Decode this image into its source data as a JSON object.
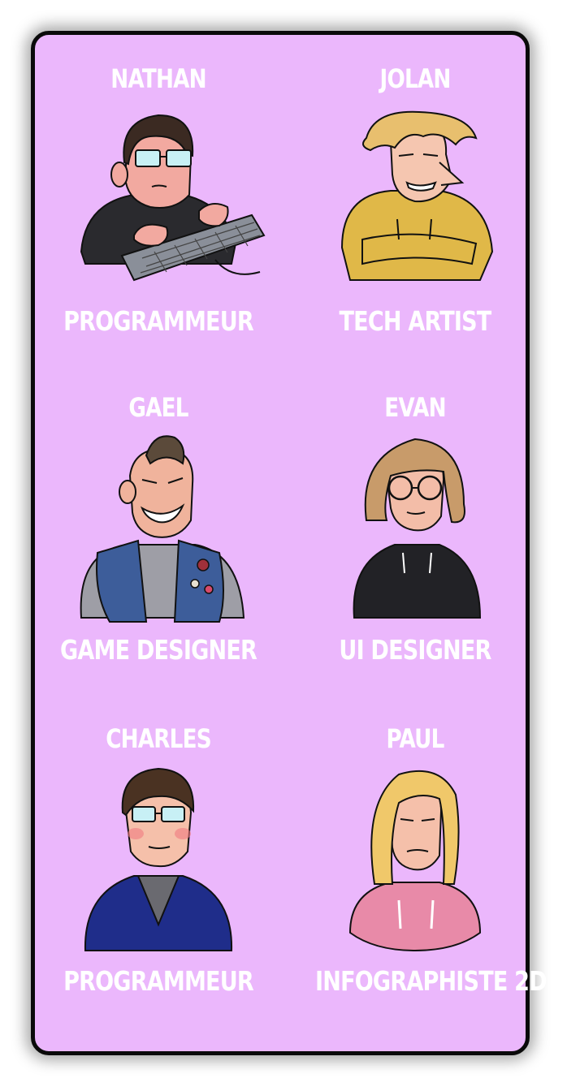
{
  "members": [
    {
      "name": "NATHAN",
      "role": "PROGRAMMEUR",
      "portrait_icon": "person-typing-keyboard-icon",
      "colors": {
        "shirt": "#2a2a2e",
        "hair": "#3b2a22",
        "skin": "#f2a9a0"
      }
    },
    {
      "name": "JOLAN",
      "role": "TECH ARTIST",
      "portrait_icon": "person-blond-arms-crossed-icon",
      "colors": {
        "shirt": "#e0b848",
        "hair": "#e8bf6e",
        "skin": "#f5c6b0"
      }
    },
    {
      "name": "GAEL",
      "role": "GAME DESIGNER",
      "portrait_icon": "person-grinning-vest-icon",
      "colors": {
        "shirt": "#3d5d9a",
        "hair": "#5b4a3a",
        "skin": "#f0b39c"
      }
    },
    {
      "name": "EVAN",
      "role": "UI DESIGNER",
      "portrait_icon": "person-long-hair-glasses-icon",
      "colors": {
        "shirt": "#222226",
        "hair": "#c89b6a",
        "skin": "#f3bda8"
      }
    },
    {
      "name": "CHARLES",
      "role": "PROGRAMMEUR",
      "portrait_icon": "person-blazer-glasses-icon",
      "colors": {
        "shirt": "#1f2d8a",
        "hair": "#4a3222",
        "skin": "#f5c0aa"
      }
    },
    {
      "name": "PAUL",
      "role": "INFOGRAPHISTE 2D",
      "portrait_icon": "person-blond-long-hair-icon",
      "colors": {
        "shirt": "#e88aa8",
        "hair": "#f0c86a",
        "skin": "#f5c0aa"
      }
    }
  ]
}
